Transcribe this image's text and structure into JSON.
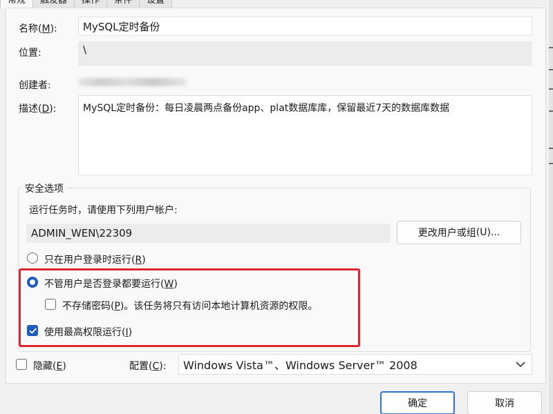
{
  "tabs": [
    {
      "label": "常规"
    },
    {
      "label": "触发器"
    },
    {
      "label": "操作"
    },
    {
      "label": "条件"
    },
    {
      "label": "设置"
    }
  ],
  "general": {
    "name_label": "名称",
    "name_accel": "M",
    "name_value": "MySQL定时备份",
    "location_label": "位置:",
    "location_value": "\\",
    "author_label": "创建者:",
    "description_label": "描述",
    "description_accel": "D",
    "description_value": "MySQL定时备份：每日凌晨两点备份app、plat数据库库，保留最近7天的数据库数据"
  },
  "security": {
    "group_title": "安全选项",
    "run_as_prompt": "运行任务时，请使用下列用户帐户:",
    "user_account": "ADMIN_WEN\\22309",
    "change_user_button": {
      "label": "更改用户或组",
      "accel": "U",
      "suffix": "..."
    },
    "radio_logged_on": {
      "label": "只在用户登录时运行",
      "accel": "R",
      "checked": false
    },
    "radio_whether_logged": {
      "label": "不管用户是否登录都要运行",
      "accel": "W",
      "checked": true
    },
    "do_not_store_password": {
      "label": "不存储密码",
      "accel": "P",
      "suffix": "。该任务将只有访问本地计算机资源的权限。",
      "checked": false
    },
    "highest_privileges": {
      "label": "使用最高权限运行",
      "accel": "I",
      "checked": true
    }
  },
  "bottom": {
    "hidden": {
      "label": "隐藏",
      "accel": "E",
      "checked": false
    },
    "configure_label": "配置",
    "configure_accel": "C",
    "configure_value": "Windows Vista™、Windows Server™ 2008"
  },
  "buttons": {
    "ok": "确定",
    "cancel": "取消"
  },
  "colors": {
    "accent": "#1e5bbf",
    "highlight": "#d9262f"
  }
}
